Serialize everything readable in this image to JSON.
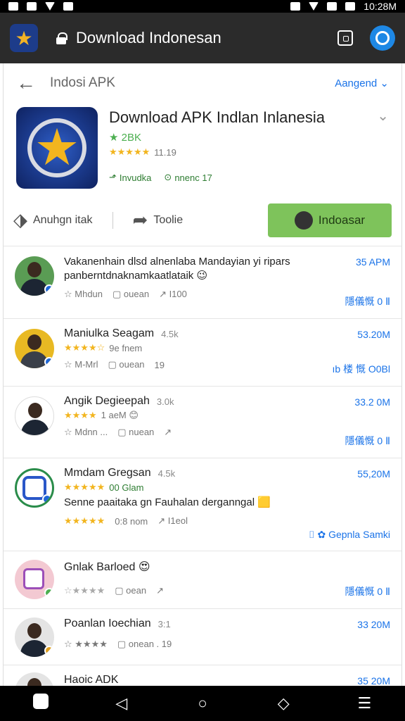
{
  "status_bar": {
    "time": "10:28M"
  },
  "browser": {
    "url_title": "Download Indonesan"
  },
  "top_nav": {
    "title": "Indosi APK",
    "language": "Aangend ⌄"
  },
  "app": {
    "title": "Download APK Indlan Inlanesia",
    "downloads": "★ 2BK",
    "rating_stars": "★★★★★",
    "rating_value": "11.19",
    "meta_1": "Invudka",
    "meta_2": "nnenc  17"
  },
  "actions": {
    "share_label": "Anuhgn itak",
    "tools_label": "Toolie",
    "download_label": "Indoasar"
  },
  "reviews": [
    {
      "name": "Vakanenhain dlsd alnenlaba Mandayian yi ripars",
      "text": "panberntdnaknamkaatlataik 😉",
      "time": "35 APM",
      "actions": [
        "☆ Mhdun",
        "▢ ouean",
        "↗ I100"
      ],
      "link": "隱儀慨 0 Ⅱ"
    },
    {
      "name": "Maniulka Seagam",
      "count": "4.5k",
      "stars": "★★★★☆",
      "stars_text": "9e fnem",
      "time": "53.20M",
      "actions": [
        "☆ M-Mrl",
        "▢ ouean",
        "19"
      ],
      "link": "ıb 楼 慨 O0Bl"
    },
    {
      "name": "Angik Degieepah",
      "count": "3.0k",
      "stars": "★★★★",
      "stars_text": "1 aeM 😊",
      "time": "33.2 0M",
      "actions": [
        "☆ Mdnn ...",
        "▢ nuean",
        "↗"
      ],
      "link": "隱儀慨 0 Ⅱ"
    },
    {
      "name": "Mmdam Gregsan",
      "count": "4.5k",
      "stars": "★★★★★",
      "stars_text": "00 Glam",
      "text": "Senne paaitaka gn Fauhalan derganngal 🟨",
      "time": "55,20M",
      "actions": [
        "★★★★★",
        "0:8 nom",
        "↗ I1eol"
      ],
      "link": "⌷ ✿ Gepnla Samki"
    },
    {
      "name": "Gnlak Barloed 😍",
      "time": "",
      "actions": [
        "☆★★★★",
        "▢ oean",
        "↗"
      ],
      "link": "隱儀慨 0 Ⅱ"
    },
    {
      "name": "Poanlan Ioechian",
      "count": "3:1",
      "stars": "★★★★",
      "time": "33 20M",
      "actions": [
        "☆ ★★★★",
        "▢ onean . 19"
      ],
      "link": ""
    },
    {
      "name": "Haoic ADK",
      "time": "35 20M"
    }
  ]
}
